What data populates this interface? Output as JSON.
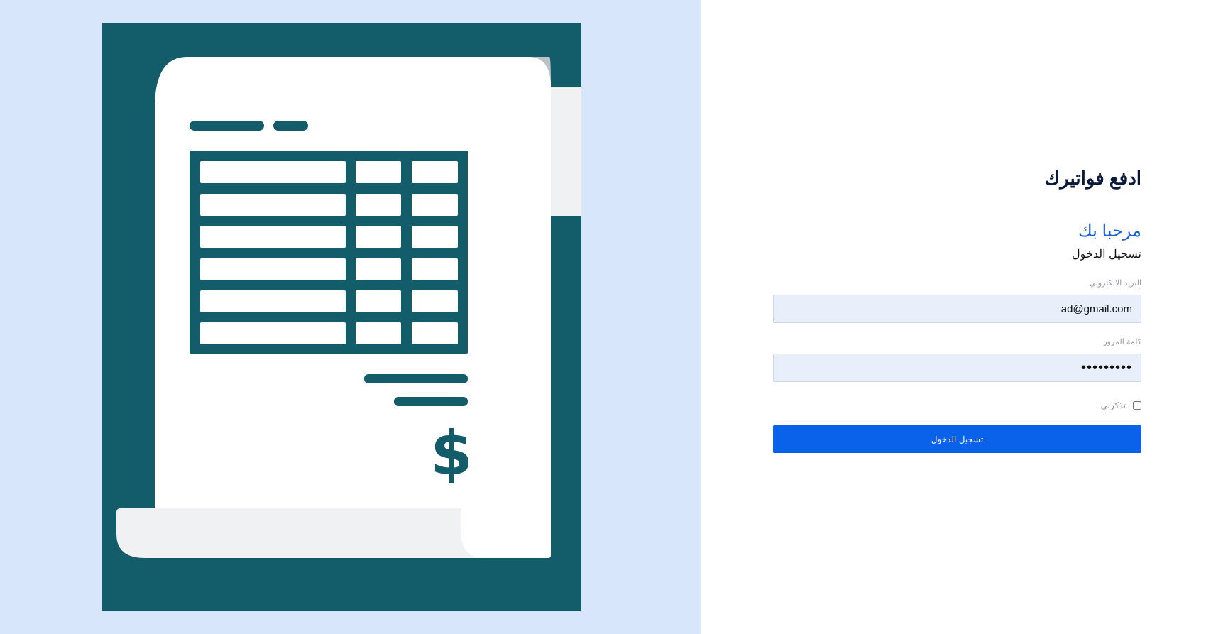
{
  "app": {
    "title": "ادفع فواتيرك"
  },
  "login": {
    "welcome": "مرحبا بك",
    "subtitle": "تسجيل الدخول",
    "email_label": "البريد الالكتروني",
    "email_value": "ad@gmail.com",
    "password_label": "كلمة المرور",
    "password_value": "123456789",
    "remember_label": "تذكرني",
    "remember_checked": false,
    "submit_label": "تسجيل الدخول"
  },
  "illustration": {
    "icon": "invoice-receipt-illustration",
    "currency_symbol": "$"
  },
  "colors": {
    "left_background": "#d8e6fb",
    "illustration_background": "#135c69",
    "paper": "#ffffff",
    "paper_fold": "#f0f1f2",
    "paper_shadow": "#bcc3c8",
    "title": "#0b1a3a",
    "welcome": "#1c5fd6",
    "input_background": "#e8effb",
    "button": "#0a62ea"
  }
}
